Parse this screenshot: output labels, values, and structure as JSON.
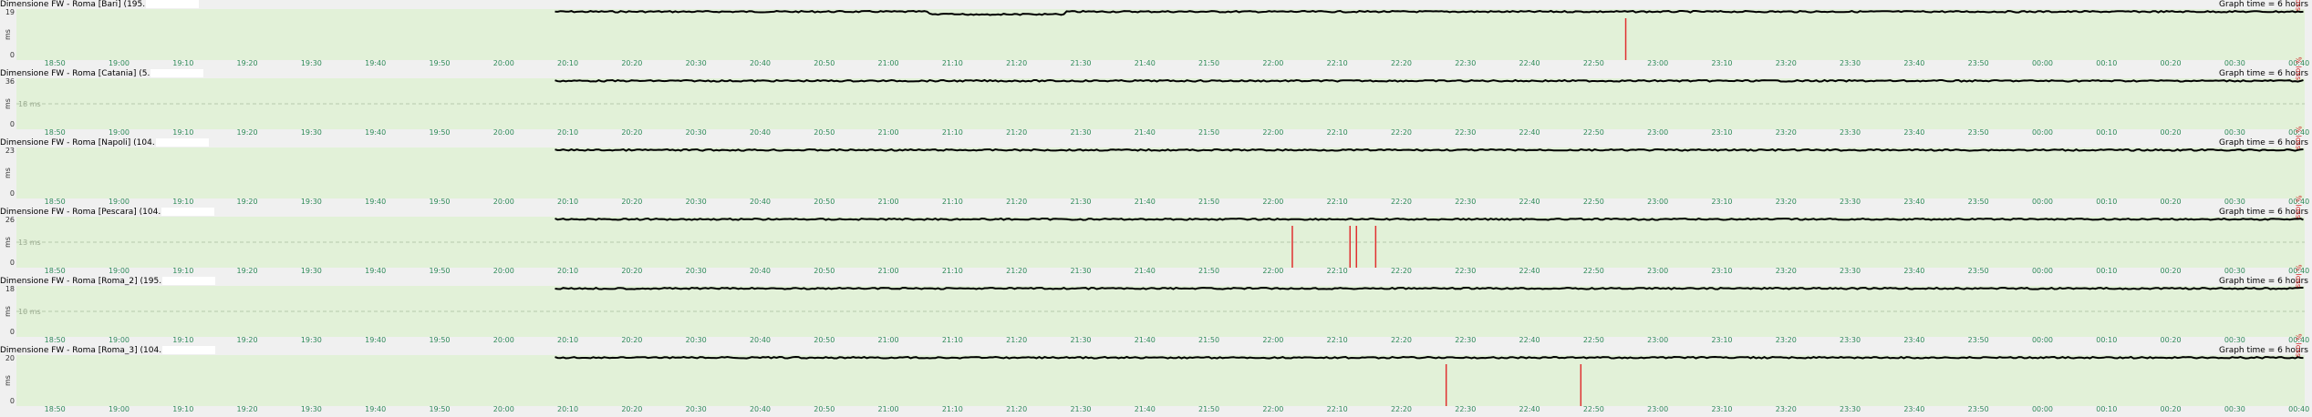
{
  "graph_time": "Graph time = 6 hours",
  "time_ticks": [
    "18:50",
    "19:00",
    "19:10",
    "19:20",
    "19:30",
    "19:40",
    "19:50",
    "20:00",
    "20:10",
    "20:20",
    "20:30",
    "20:40",
    "20:50",
    "21:00",
    "21:10",
    "21:20",
    "21:30",
    "21:40",
    "21:50",
    "22:00",
    "22:10",
    "22:20",
    "22:30",
    "22:40",
    "22:50",
    "23:00",
    "23:10",
    "23:20",
    "23:30",
    "23:40",
    "23:50",
    "00:00",
    "00:10",
    "00:20",
    "00:30",
    "00:40"
  ],
  "y_unit": "ms",
  "right_label": "% loss",
  "colors": {
    "plot_bg": "#e2f1d8",
    "latency": "#000000",
    "loss": "#e03030",
    "ticks": "#2e8b57"
  },
  "panels": [
    {
      "title": "Dimensione FW - Roma [Bari] (195.",
      "y_top": "19",
      "y_mid": "",
      "y_bottom": "0",
      "data_start": "20:08",
      "loss_events": [
        "22:55"
      ]
    },
    {
      "title": "Dimensione FW - Roma [Catania] (5.",
      "y_top": "36",
      "y_mid": "18 ms",
      "y_bottom": "0",
      "data_start": "20:08",
      "loss_events": []
    },
    {
      "title": "Dimensione FW - Roma [Napoli] (104.",
      "y_top": "23",
      "y_mid": "",
      "y_bottom": "0",
      "data_start": "20:08",
      "loss_events": []
    },
    {
      "title": "Dimensione FW - Roma [Pescara] (104.",
      "y_top": "26",
      "y_mid": "13 ms",
      "y_bottom": "0",
      "data_start": "20:08",
      "loss_events": [
        "22:03",
        "22:12",
        "22:13",
        "22:16"
      ]
    },
    {
      "title": "Dimensione FW - Roma [Roma_2] (195.",
      "y_top": "18",
      "y_mid": "10 ms",
      "y_bottom": "0",
      "data_start": "20:08",
      "loss_events": []
    },
    {
      "title": "Dimensione FW - Roma [Roma_3] (104.",
      "y_top": "20",
      "y_mid": "",
      "y_bottom": "0",
      "data_start": "20:08",
      "loss_events": [
        "22:27",
        "22:48"
      ]
    }
  ]
}
